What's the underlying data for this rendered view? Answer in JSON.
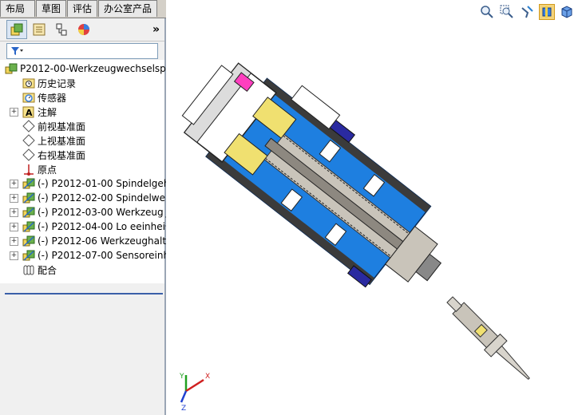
{
  "command_tabs": [
    "布局",
    "草图",
    "评估",
    "办公室产品"
  ],
  "feature_tree": {
    "root": "P2012-00-Werkzeugwechselsp",
    "items": [
      {
        "label": "历史记录",
        "icon": "history-folder-icon",
        "expand": false
      },
      {
        "label": "传感器",
        "icon": "sensor-icon",
        "expand": false
      },
      {
        "label": "注解",
        "icon": "annotation-icon",
        "expand": true
      },
      {
        "label": "前视基准面",
        "icon": "plane-icon",
        "expand": false
      },
      {
        "label": "上视基准面",
        "icon": "plane-icon",
        "expand": false
      },
      {
        "label": "右视基准面",
        "icon": "plane-icon",
        "expand": false
      },
      {
        "label": "原点",
        "icon": "origin-icon",
        "expand": false
      },
      {
        "label": "(-) P2012-01-00 Spindelgeh",
        "icon": "subassembly-icon",
        "expand": true
      },
      {
        "label": "(-) P2012-02-00 Spindelwel",
        "icon": "subassembly-icon",
        "expand": true
      },
      {
        "label": "(-) P2012-03-00 Werkzeug",
        "icon": "subassembly-icon",
        "expand": true
      },
      {
        "label": "(-) P2012-04-00 Lo eeinhei",
        "icon": "subassembly-icon",
        "expand": true
      },
      {
        "label": "(-) P2012-06 Werkzeughalt",
        "icon": "subassembly-icon",
        "expand": true
      },
      {
        "label": "(-) P2012-07-00 Sensoreinh",
        "icon": "subassembly-icon",
        "expand": true
      },
      {
        "label": "配合",
        "icon": "mates-icon",
        "expand": false
      }
    ]
  },
  "panel_chevron": "»",
  "triad": {
    "x": "X",
    "y": "Y",
    "z": "Z"
  },
  "colors": {
    "accent": "#3a5fa8",
    "housing_blue": "#1e7fe0",
    "yellow": "#f0e070",
    "magenta": "#ff3fbf"
  }
}
